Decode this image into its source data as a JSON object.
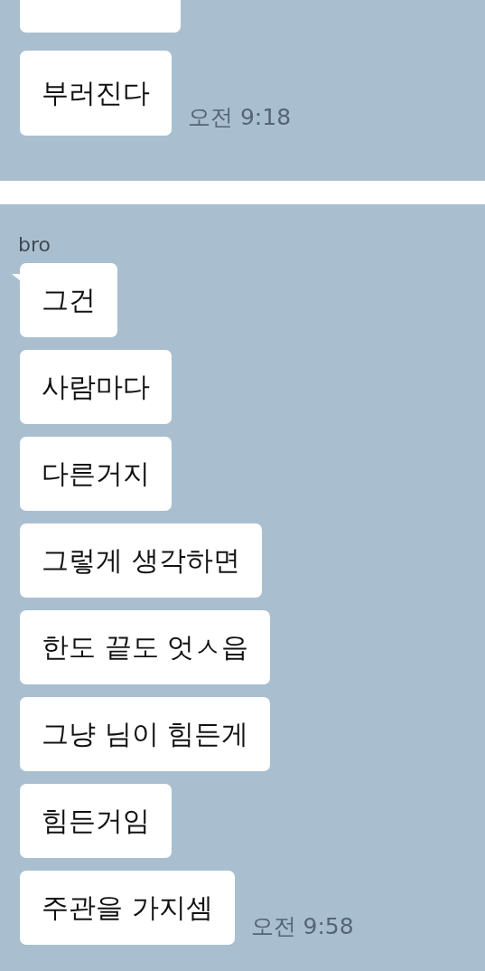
{
  "sections": [
    {
      "messages": [
        {
          "kind": "partial"
        },
        {
          "kind": "text",
          "text": "부러진다"
        }
      ],
      "time": "오전 9:18"
    },
    {
      "sender": "bro",
      "messages": [
        {
          "kind": "text",
          "text": "그건"
        },
        {
          "kind": "text",
          "text": "사람마다"
        },
        {
          "kind": "text",
          "text": "다른거지"
        },
        {
          "kind": "text",
          "text": "그렇게 생각하면"
        },
        {
          "kind": "text",
          "text": "한도 끝도 엇ㅅ읍"
        },
        {
          "kind": "text",
          "text": "그냥 님이 힘든게"
        },
        {
          "kind": "text",
          "text": "힘든거임"
        },
        {
          "kind": "text",
          "text": "주관을 가지셈"
        }
      ],
      "time": "오전 9:58"
    }
  ]
}
